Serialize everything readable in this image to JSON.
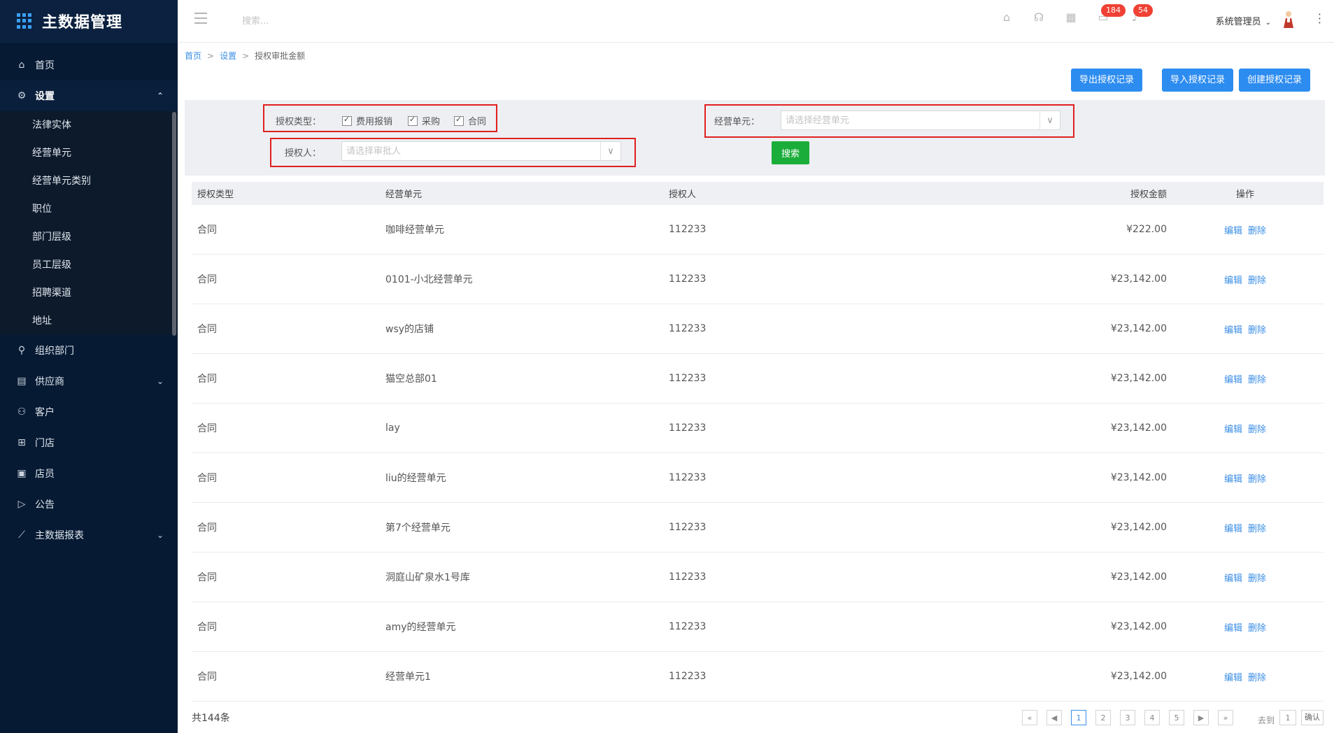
{
  "app": {
    "title": "主数据管理"
  },
  "sidebar": {
    "items": [
      {
        "label": "首页",
        "icon": "home-icon"
      },
      {
        "label": "设置",
        "icon": "gear-icon",
        "expanded": true,
        "children": [
          "法律实体",
          "经营单元",
          "经营单元类别",
          "职位",
          "部门层级",
          "员工层级",
          "招聘渠道",
          "地址"
        ]
      },
      {
        "label": "组织部门",
        "icon": "org-icon"
      },
      {
        "label": "供应商",
        "icon": "supplier-icon",
        "has_children": true
      },
      {
        "label": "客户",
        "icon": "customer-icon"
      },
      {
        "label": "门店",
        "icon": "store-icon"
      },
      {
        "label": "店员",
        "icon": "clerk-icon"
      },
      {
        "label": "公告",
        "icon": "notice-icon"
      },
      {
        "label": "主数据报表",
        "icon": "chart-icon",
        "has_children": true
      }
    ]
  },
  "topbar": {
    "search_placeholder": "搜索...",
    "badge_messages": "184",
    "badge_notifications": "54",
    "user_name": "系统管理员"
  },
  "breadcrumb": {
    "home": "首页",
    "settings": "设置",
    "current": "授权审批金额",
    "sep": ">"
  },
  "actions": {
    "export": "导出授权记录",
    "import": "导入授权记录",
    "create": "创建授权记录"
  },
  "filter": {
    "auth_type_label": "授权类型：",
    "auth_types": [
      "费用报销",
      "采购",
      "合同"
    ],
    "business_unit_label": "经营单元：",
    "business_unit_placeholder": "请选择经营单元",
    "approver_label": "授权人：",
    "approver_placeholder": "请选择审批人",
    "search_button": "搜索"
  },
  "table": {
    "headers": [
      "授权类型",
      "经营单元",
      "授权人",
      "授权金额",
      "操作"
    ],
    "edit_label": "编辑",
    "delete_label": "删除",
    "rows": [
      {
        "type": "合同",
        "unit": "咖啡经营单元",
        "approver": "112233",
        "amount": "¥222.00"
      },
      {
        "type": "合同",
        "unit": "0101-小北经营单元",
        "approver": "112233",
        "amount": "¥23,142.00"
      },
      {
        "type": "合同",
        "unit": "wsy的店铺",
        "approver": "112233",
        "amount": "¥23,142.00"
      },
      {
        "type": "合同",
        "unit": "猫空总部01",
        "approver": "112233",
        "amount": "¥23,142.00"
      },
      {
        "type": "合同",
        "unit": "lay",
        "approver": "112233",
        "amount": "¥23,142.00"
      },
      {
        "type": "合同",
        "unit": "liu的经营单元",
        "approver": "112233",
        "amount": "¥23,142.00"
      },
      {
        "type": "合同",
        "unit": "第7个经营单元",
        "approver": "112233",
        "amount": "¥23,142.00"
      },
      {
        "type": "合同",
        "unit": "洞庭山矿泉水1号库",
        "approver": "112233",
        "amount": "¥23,142.00"
      },
      {
        "type": "合同",
        "unit": "amy的经营单元",
        "approver": "112233",
        "amount": "¥23,142.00"
      },
      {
        "type": "合同",
        "unit": "经营单元1",
        "approver": "112233",
        "amount": "¥23,142.00"
      }
    ]
  },
  "footer": {
    "total": "共144条",
    "pages": [
      "1",
      "2",
      "3",
      "4",
      "5"
    ],
    "first": "«",
    "last": "»",
    "goto_label": "去到",
    "goto_value": "1",
    "confirm": "确认"
  }
}
